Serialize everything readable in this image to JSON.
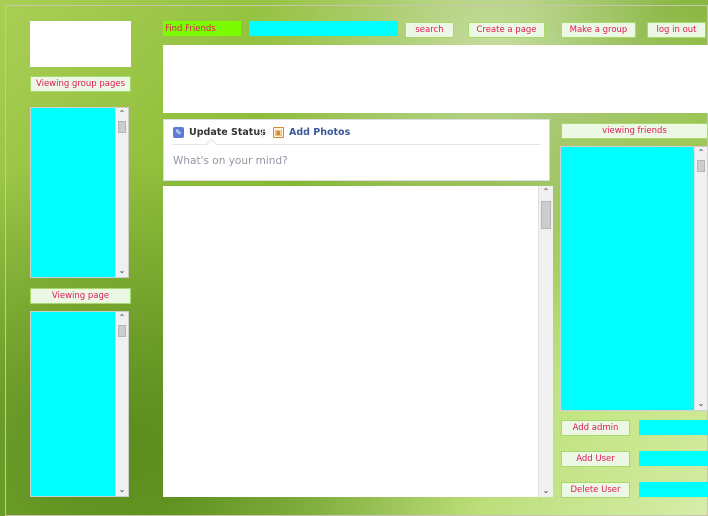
{
  "left_panel": {
    "viewing_group_pages_label": "Viewing group pages",
    "viewing_page_label": "Viewing page"
  },
  "top_bar": {
    "find_friends_label": "Find Friends",
    "search_value": "",
    "search_button": "search",
    "create_page_button": "Create a page",
    "make_group_button": "Make a group",
    "log_in_out_button": "log in out"
  },
  "status_composer": {
    "tab_update_status": "Update Status",
    "tab_add_photos": "Add Photos",
    "placeholder": "What's on your mind?"
  },
  "right_panel": {
    "viewing_friends_label": "viewing friends",
    "add_admin_button": "Add admin",
    "add_user_button": "Add User",
    "delete_user_button": "Delete User",
    "admin_value": "",
    "user_value": "",
    "delete_value": ""
  },
  "colors": {
    "accent_text": "#e0195a",
    "cyan": "#00ffff",
    "find_label_bg": "#7cfc00"
  },
  "icons": {
    "update_status": "pencil-icon",
    "add_photos": "photo-icon"
  }
}
